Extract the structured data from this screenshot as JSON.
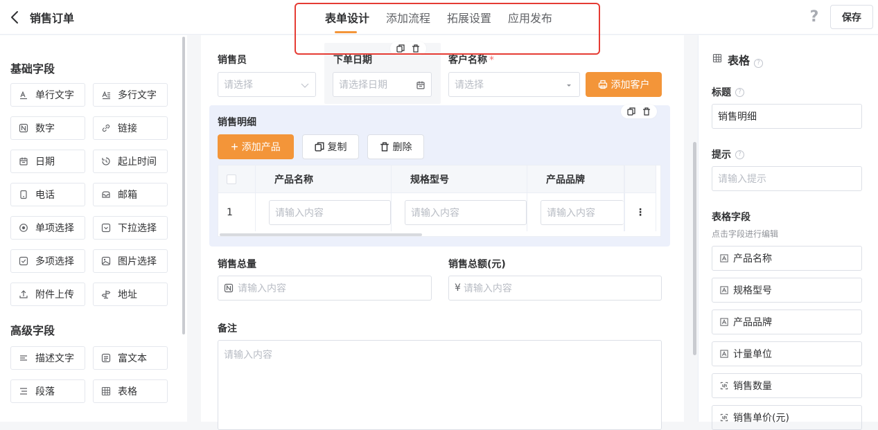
{
  "header": {
    "title": "销售订单",
    "tabs": [
      "表单设计",
      "添加流程",
      "拓展设置",
      "应用发布"
    ],
    "active_tab": "表单设计",
    "help_label": "?",
    "save_label": "保存"
  },
  "left": {
    "basic_title": "基础字段",
    "basic_fields": [
      {
        "label": "单行文字",
        "icon": "single-line-text-icon"
      },
      {
        "label": "多行文字",
        "icon": "multi-line-text-icon"
      },
      {
        "label": "数字",
        "icon": "number-icon"
      },
      {
        "label": "链接",
        "icon": "link-icon"
      },
      {
        "label": "日期",
        "icon": "date-icon"
      },
      {
        "label": "起止时间",
        "icon": "time-range-icon"
      },
      {
        "label": "电话",
        "icon": "phone-icon"
      },
      {
        "label": "邮箱",
        "icon": "mailbox-icon"
      },
      {
        "label": "单项选择",
        "icon": "radio-icon"
      },
      {
        "label": "下拉选择",
        "icon": "dropdown-icon"
      },
      {
        "label": "多项选择",
        "icon": "checkbox-icon"
      },
      {
        "label": "图片选择",
        "icon": "image-icon"
      },
      {
        "label": "附件上传",
        "icon": "upload-icon"
      },
      {
        "label": "地址",
        "icon": "address-icon"
      }
    ],
    "advanced_title": "高级字段",
    "advanced_fields": [
      {
        "label": "描述文字",
        "icon": "description-icon"
      },
      {
        "label": "富文本",
        "icon": "rich-text-icon"
      },
      {
        "label": "段落",
        "icon": "paragraph-icon"
      },
      {
        "label": "表格",
        "icon": "table-icon"
      }
    ]
  },
  "canvas": {
    "salesperson": {
      "label": "销售员",
      "placeholder": "请选择"
    },
    "order_date": {
      "label": "下单日期",
      "placeholder": "请选择日期"
    },
    "customer": {
      "label": "客户名称",
      "required_mark": "*",
      "placeholder": "请选择",
      "add_button": "添加客户"
    },
    "detail": {
      "title": "销售明细",
      "add_product": "添加产品",
      "copy": "复制",
      "delete": "删除",
      "columns": [
        "产品名称",
        "规格型号",
        "产品品牌"
      ],
      "rows": [
        {
          "index": "1",
          "placeholders": [
            "请输入内容",
            "请输入内容",
            "请输入内容"
          ]
        }
      ],
      "row_menu": "⋮"
    },
    "total_qty": {
      "label": "销售总量",
      "placeholder": "请输入内容"
    },
    "total_amount": {
      "label": "销售总额(元)",
      "prefix": "¥",
      "placeholder": "请输入内容"
    },
    "remark": {
      "label": "备注",
      "placeholder": "请输入内容"
    }
  },
  "props": {
    "title": "表格",
    "title_label": "标题",
    "title_value": "销售明细",
    "hint_label": "提示",
    "hint_placeholder": "请输入提示",
    "columns_label": "表格字段",
    "columns_sub": "点击字段进行编辑",
    "columns": [
      {
        "label": "产品名称",
        "icon": "text-field-icon"
      },
      {
        "label": "规格型号",
        "icon": "text-field-icon"
      },
      {
        "label": "产品品牌",
        "icon": "text-field-icon"
      },
      {
        "label": "计量单位",
        "icon": "text-field-icon"
      },
      {
        "label": "销售数量",
        "icon": "number-field-icon"
      },
      {
        "label": "销售单价(元)",
        "icon": "number-field-icon"
      }
    ]
  },
  "colors": {
    "accent": "#f39539",
    "highlight_border": "#e53b33",
    "detail_bg": "#ecf0fb"
  }
}
